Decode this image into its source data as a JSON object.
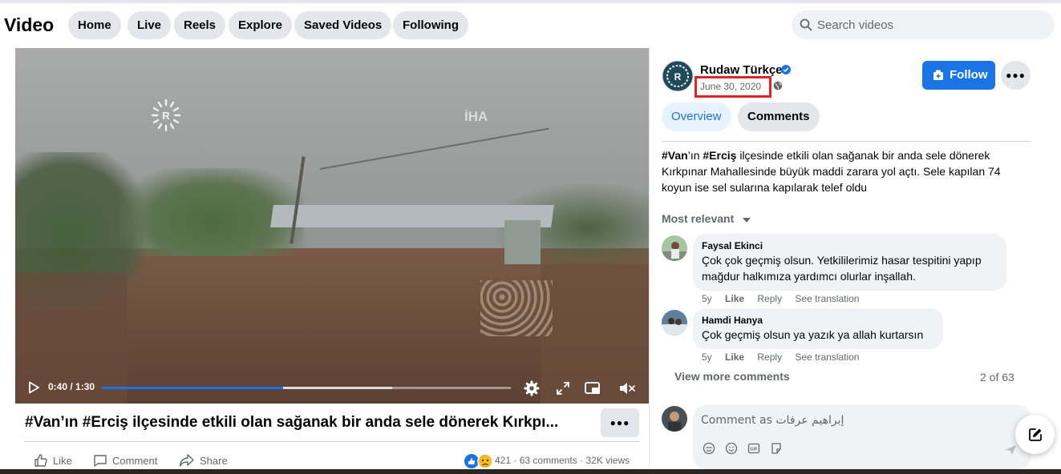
{
  "header": {
    "title": "Video",
    "nav": [
      "Home",
      "Live",
      "Reels",
      "Explore",
      "Saved Videos",
      "Following"
    ],
    "search_placeholder": "Search videos"
  },
  "player": {
    "time": "0:40 / 1:30",
    "progress_fraction": 0.444,
    "buffered_fraction": 0.71,
    "watermark_iha": "İHA"
  },
  "video": {
    "title": "#Van’ın #Erciş ilçesinde etkili olan sağanak bir anda sele dönerek Kırkpı...",
    "like_label": "Like",
    "comment_label": "Comment",
    "share_label": "Share",
    "reaction_count": "421",
    "comments_count": "63 comments",
    "views": "32K views",
    "stats_sep": "·"
  },
  "post": {
    "page_name": "Rudaw Türkçe",
    "date": "June 30, 2020",
    "follow_label": "Follow",
    "tabs": [
      "Overview",
      "Comments"
    ],
    "desc_tag1": "#Van",
    "desc_part1": "’ın ",
    "desc_tag2": "#Erciş",
    "desc_part2": " ilçesinde etkili olan sağanak bir anda sele dönerek Kırkpınar Mahallesinde büyük maddi zarara yol açtı. Sele kapılan 74 koyun ise sel sularına kapılarak telef oldu"
  },
  "comments": {
    "sort_label": "Most relevant",
    "items": [
      {
        "author": "Faysal Ekinci",
        "text": "Çok çok geçmiş olsun. Yetkililerimiz hasar tespitini yapıp mağdur halkımıza yardımcı olurlar inşallah.",
        "age": "5y",
        "like": "Like",
        "reply": "Reply",
        "translate": "See translation"
      },
      {
        "author": "Hamdi Hanya",
        "text": "Çok geçmiş olsun ya yazık ya allah kurtarsın",
        "age": "5y",
        "like": "Like",
        "reply": "Reply",
        "translate": "See translation"
      }
    ],
    "view_more": "View more comments",
    "count_of": "2 of 63",
    "input_placeholder": "Comment as إبراهيم عرفات"
  },
  "colors": {
    "accent": "#1b74e4",
    "highlight_box": "#e02424",
    "pill_bg": "#e4e6eb",
    "secondary_text": "#65676b"
  }
}
